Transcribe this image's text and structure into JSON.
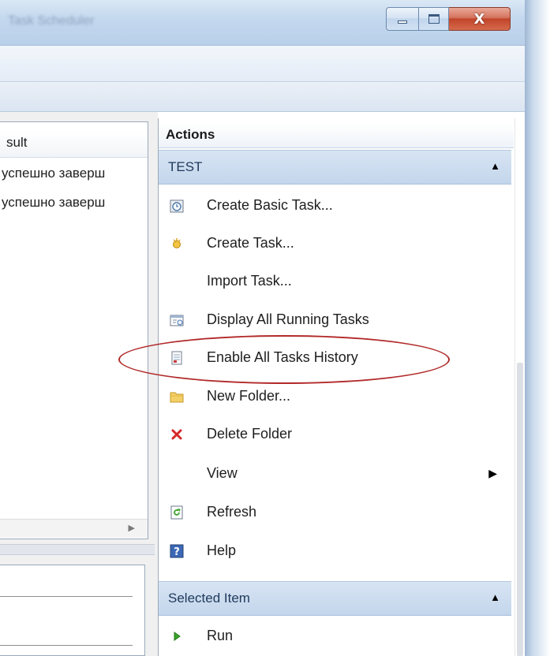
{
  "window": {
    "title": "Task Scheduler",
    "buttons": {
      "minimize": "minimize",
      "maximize": "maximize",
      "close": "X"
    }
  },
  "task_list": {
    "column_header": "sult",
    "rows": [
      {
        "result": "успешно заверш"
      },
      {
        "result": "успешно заверш"
      }
    ]
  },
  "actions": {
    "title": "Actions",
    "sections": [
      {
        "label": "TEST",
        "items": [
          {
            "label": "Create Basic Task...",
            "icon": "create-basic-task-icon"
          },
          {
            "label": "Create Task...",
            "icon": "create-task-icon"
          },
          {
            "label": "Import Task...",
            "icon": ""
          },
          {
            "label": "Display All Running Tasks",
            "icon": "running-tasks-icon"
          },
          {
            "label": "Enable All Tasks History",
            "icon": "history-icon"
          },
          {
            "label": "New Folder...",
            "icon": "folder-icon"
          },
          {
            "label": "Delete Folder",
            "icon": "delete-icon"
          },
          {
            "label": "View",
            "icon": ""
          },
          {
            "label": "Refresh",
            "icon": "refresh-icon"
          },
          {
            "label": "Help",
            "icon": "help-icon"
          }
        ]
      },
      {
        "label": "Selected Item",
        "items": [
          {
            "label": "Run",
            "icon": "run-icon"
          }
        ]
      }
    ]
  },
  "colors": {
    "highlight": "#b22a2a",
    "section_header": "#c9daee",
    "delete": "#d62828",
    "run": "#3aa52c"
  }
}
